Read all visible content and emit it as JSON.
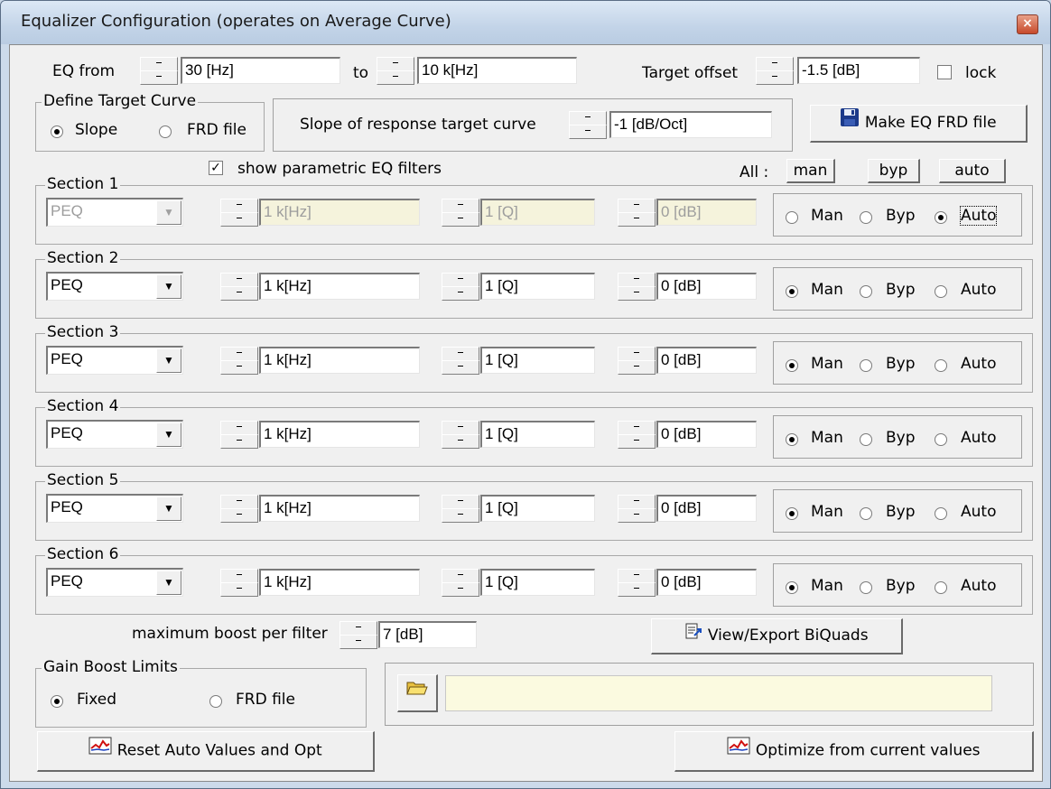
{
  "window": {
    "title": "Equalizer Configuration (operates on Average Curve)",
    "close_symbol": "×"
  },
  "top": {
    "eq_from_label": "EQ from",
    "eq_from_value": "30 [Hz]",
    "to_label": "to",
    "to_value": "10 k[Hz]",
    "target_offset_label": "Target offset",
    "target_offset_value": "-1.5 [dB]",
    "lock_label": "lock",
    "lock_checked": false
  },
  "target_curve": {
    "group_label": "Define Target Curve",
    "slope_label": "Slope",
    "frd_label": "FRD file",
    "selected": "slope",
    "slope_prompt": "Slope of response target curve",
    "slope_value": "-1 [dB/Oct]",
    "make_eq_button": "Make EQ FRD file"
  },
  "peq": {
    "show_label": "show parametric EQ filters",
    "show_checked": true,
    "all_label": "All :",
    "man_btn": "man",
    "byp_btn": "byp",
    "auto_btn": "auto",
    "mode_labels": {
      "man": "Man",
      "byp": "Byp",
      "auto": "Auto"
    },
    "sections": [
      {
        "label": "Section 1",
        "type": "PEQ",
        "freq": "1 k[Hz]",
        "q": "1 [Q]",
        "gain": "0 [dB]",
        "mode": "auto",
        "disabled": true
      },
      {
        "label": "Section 2",
        "type": "PEQ",
        "freq": "1 k[Hz]",
        "q": "1 [Q]",
        "gain": "0 [dB]",
        "mode": "man",
        "disabled": false
      },
      {
        "label": "Section 3",
        "type": "PEQ",
        "freq": "1 k[Hz]",
        "q": "1 [Q]",
        "gain": "0 [dB]",
        "mode": "man",
        "disabled": false
      },
      {
        "label": "Section 4",
        "type": "PEQ",
        "freq": "1 k[Hz]",
        "q": "1 [Q]",
        "gain": "0 [dB]",
        "mode": "man",
        "disabled": false
      },
      {
        "label": "Section 5",
        "type": "PEQ",
        "freq": "1 k[Hz]",
        "q": "1 [Q]",
        "gain": "0 [dB]",
        "mode": "man",
        "disabled": false
      },
      {
        "label": "Section 6",
        "type": "PEQ",
        "freq": "1 k[Hz]",
        "q": "1 [Q]",
        "gain": "0 [dB]",
        "mode": "man",
        "disabled": false
      }
    ]
  },
  "bottom": {
    "max_boost_label": "maximum boost per filter",
    "max_boost_value": "7 [dB]",
    "view_export_button": "View/Export BiQuads",
    "gain_group_label": "Gain Boost Limits",
    "fixed_label": "Fixed",
    "frd_label": "FRD file",
    "gain_selected": "fixed",
    "file_path": "",
    "reset_button": "Reset Auto Values and Opt",
    "optimize_button": "Optimize from current values"
  },
  "colors": {
    "titlebar": "#c3d4e8",
    "dialog_bg": "#f0f0f0",
    "disabled_field": "#f5f3dc",
    "close_button": "#c74a2c"
  },
  "icons": [
    "close-icon",
    "floppy-disk-icon",
    "export-icon",
    "folder-open-icon",
    "chart-icon"
  ]
}
